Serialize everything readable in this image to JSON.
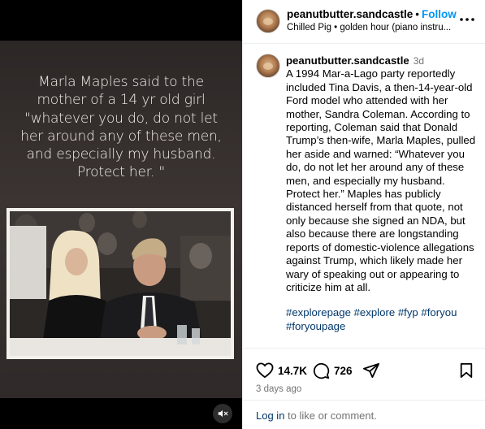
{
  "media": {
    "quote_text": "Marla Maples said to the mother of a 14 yr old girl \"whatever you do, do not let her around any of these men, and especially my husband. Protect her. \""
  },
  "header": {
    "username": "peanutbutter.sandcastle",
    "separator": "•",
    "follow_label": "Follow",
    "audio_label": "Chilled Pig • golden hour (piano instru..."
  },
  "caption": {
    "username": "peanutbutter.sandcastle",
    "time": "3d",
    "text": "A 1994 Mar-a-Lago party reportedly included Tina Davis, a then-14-year-old Ford model who attended with her mother, Sandra Coleman. According to reporting, Coleman said that Donald Trump’s then-wife, Marla Maples, pulled her aside and warned: “Whatever you do, do not let her around any of these men, and especially my husband. Protect her.” Maples has publicly distanced herself from that quote, not only because she signed an NDA, but also because there are longstanding reports of domestic-violence allegations against Trump, which likely made her wary of speaking out or appearing to criticize him at all.",
    "hashtags": "#explorepage #explore #fyp #foryou #foryoupage"
  },
  "actions": {
    "likes": "14.7K",
    "comments": "726",
    "date": "3 days ago"
  },
  "footer": {
    "login_link": "Log in",
    "login_rest": " to like or comment."
  }
}
